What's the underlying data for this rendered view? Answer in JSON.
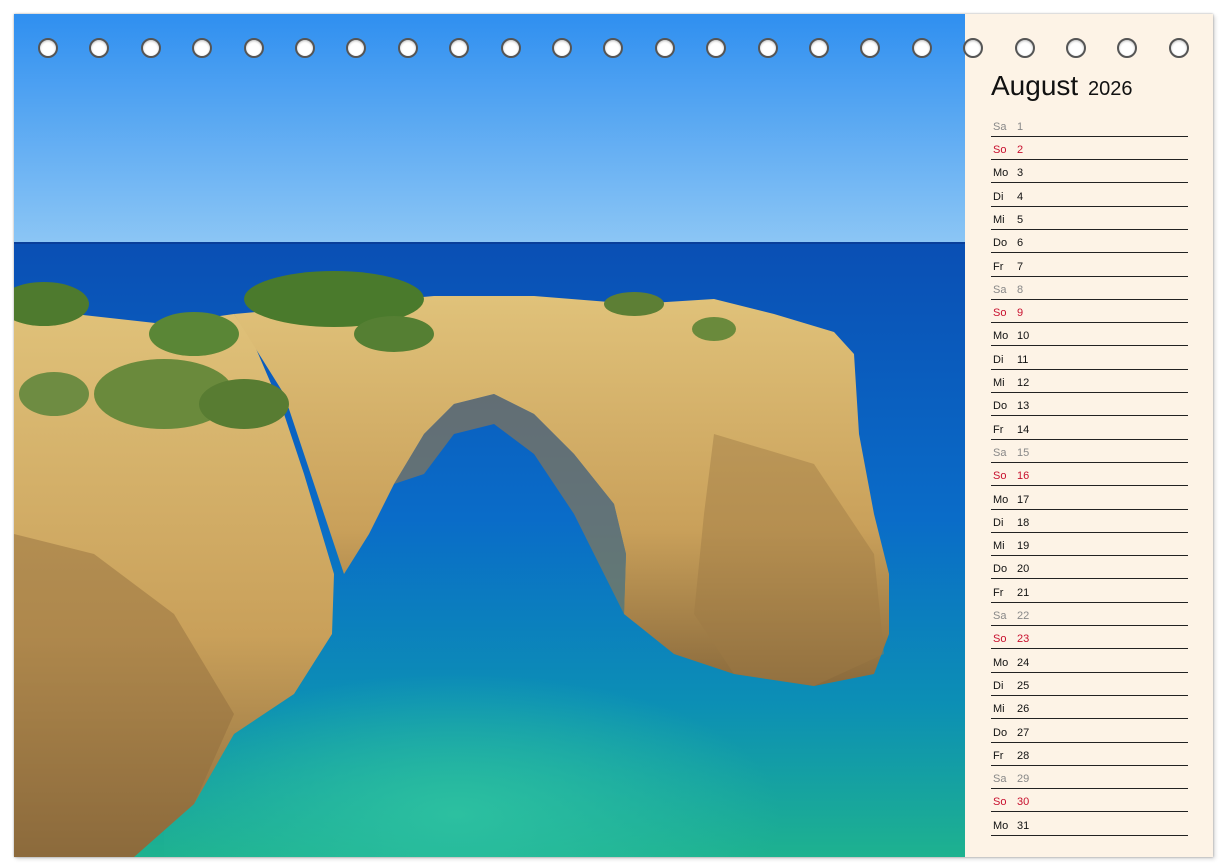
{
  "calendar": {
    "month": "August",
    "year": "2026",
    "days": [
      {
        "name": "Sa",
        "num": "1",
        "type": "sat"
      },
      {
        "name": "So",
        "num": "2",
        "type": "sun"
      },
      {
        "name": "Mo",
        "num": "3",
        "type": "week"
      },
      {
        "name": "Di",
        "num": "4",
        "type": "week"
      },
      {
        "name": "Mi",
        "num": "5",
        "type": "week"
      },
      {
        "name": "Do",
        "num": "6",
        "type": "week"
      },
      {
        "name": "Fr",
        "num": "7",
        "type": "week"
      },
      {
        "name": "Sa",
        "num": "8",
        "type": "sat"
      },
      {
        "name": "So",
        "num": "9",
        "type": "sun"
      },
      {
        "name": "Mo",
        "num": "10",
        "type": "week"
      },
      {
        "name": "Di",
        "num": "11",
        "type": "week"
      },
      {
        "name": "Mi",
        "num": "12",
        "type": "week"
      },
      {
        "name": "Do",
        "num": "13",
        "type": "week"
      },
      {
        "name": "Fr",
        "num": "14",
        "type": "week"
      },
      {
        "name": "Sa",
        "num": "15",
        "type": "sat"
      },
      {
        "name": "So",
        "num": "16",
        "type": "sun"
      },
      {
        "name": "Mo",
        "num": "17",
        "type": "week"
      },
      {
        "name": "Di",
        "num": "18",
        "type": "week"
      },
      {
        "name": "Mi",
        "num": "19",
        "type": "week"
      },
      {
        "name": "Do",
        "num": "20",
        "type": "week"
      },
      {
        "name": "Fr",
        "num": "21",
        "type": "week"
      },
      {
        "name": "Sa",
        "num": "22",
        "type": "sat"
      },
      {
        "name": "So",
        "num": "23",
        "type": "sun"
      },
      {
        "name": "Mo",
        "num": "24",
        "type": "week"
      },
      {
        "name": "Di",
        "num": "25",
        "type": "week"
      },
      {
        "name": "Mi",
        "num": "26",
        "type": "week"
      },
      {
        "name": "Do",
        "num": "27",
        "type": "week"
      },
      {
        "name": "Fr",
        "num": "28",
        "type": "week"
      },
      {
        "name": "Sa",
        "num": "29",
        "type": "sat"
      },
      {
        "name": "So",
        "num": "30",
        "type": "sun"
      },
      {
        "name": "Mo",
        "num": "31",
        "type": "week"
      }
    ]
  },
  "colors": {
    "panel_background": "#fdf3e6",
    "sunday": "#c8102e",
    "saturday": "#888888",
    "weekday": "#111111"
  }
}
